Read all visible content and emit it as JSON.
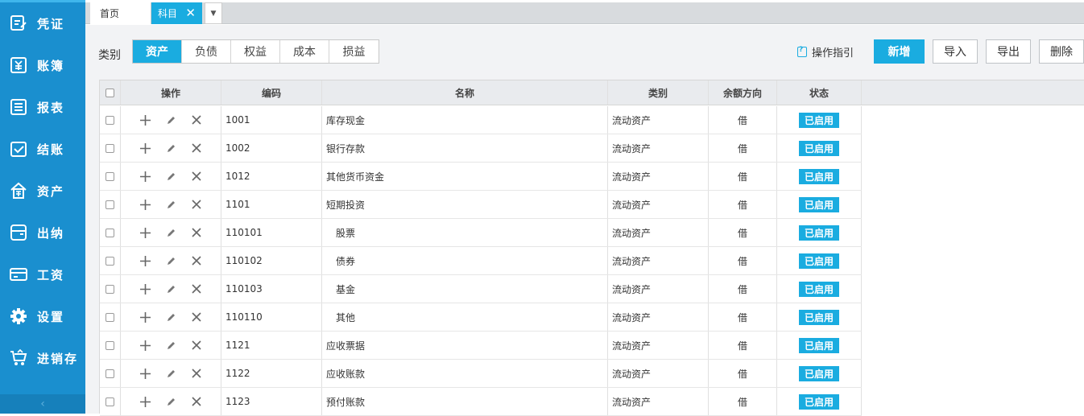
{
  "sidebar": {
    "items": [
      {
        "label": "凭证",
        "icon": "voucher-icon"
      },
      {
        "label": "账簿",
        "icon": "ledger-icon"
      },
      {
        "label": "报表",
        "icon": "report-icon"
      },
      {
        "label": "结账",
        "icon": "checkout-icon"
      },
      {
        "label": "资产",
        "icon": "asset-icon"
      },
      {
        "label": "出纳",
        "icon": "cashier-icon"
      },
      {
        "label": "工资",
        "icon": "salary-icon"
      },
      {
        "label": "设置",
        "icon": "gear-icon"
      },
      {
        "label": "进销存",
        "icon": "cart-icon"
      }
    ],
    "collapse_glyph": "‹"
  },
  "tabs": {
    "home": "首页",
    "active": "科目",
    "close_glyph": "✕",
    "more_glyph": "▼"
  },
  "toolbar": {
    "category_label": "类别",
    "segments": [
      "资产",
      "负债",
      "权益",
      "成本",
      "损益"
    ],
    "active_segment": "资产",
    "guide_label": "操作指引",
    "new_label": "新增",
    "import_label": "导入",
    "export_label": "导出",
    "delete_label": "删除"
  },
  "table": {
    "headers": {
      "ops": "操作",
      "code": "编码",
      "name": "名称",
      "category": "类别",
      "direction": "余额方向",
      "status": "状态"
    },
    "rows": [
      {
        "code": "1001",
        "name": "库存现金",
        "category": "流动资产",
        "direction": "借",
        "status": "已启用",
        "indent": false
      },
      {
        "code": "1002",
        "name": "银行存款",
        "category": "流动资产",
        "direction": "借",
        "status": "已启用",
        "indent": false
      },
      {
        "code": "1012",
        "name": "其他货币资金",
        "category": "流动资产",
        "direction": "借",
        "status": "已启用",
        "indent": false
      },
      {
        "code": "1101",
        "name": "短期投资",
        "category": "流动资产",
        "direction": "借",
        "status": "已启用",
        "indent": false
      },
      {
        "code": "110101",
        "name": "股票",
        "category": "流动资产",
        "direction": "借",
        "status": "已启用",
        "indent": true
      },
      {
        "code": "110102",
        "name": "债券",
        "category": "流动资产",
        "direction": "借",
        "status": "已启用",
        "indent": true
      },
      {
        "code": "110103",
        "name": "基金",
        "category": "流动资产",
        "direction": "借",
        "status": "已启用",
        "indent": true
      },
      {
        "code": "110110",
        "name": "其他",
        "category": "流动资产",
        "direction": "借",
        "status": "已启用",
        "indent": true
      },
      {
        "code": "1121",
        "name": "应收票据",
        "category": "流动资产",
        "direction": "借",
        "status": "已启用",
        "indent": false
      },
      {
        "code": "1122",
        "name": "应收账款",
        "category": "流动资产",
        "direction": "借",
        "status": "已启用",
        "indent": false
      },
      {
        "code": "1123",
        "name": "预付账款",
        "category": "流动资产",
        "direction": "借",
        "status": "已启用",
        "indent": false
      }
    ]
  },
  "colors": {
    "sidebar_bg": "#1a8fcf",
    "accent": "#1aace0",
    "header_bg": "#e9ebee",
    "content_bg": "#f2f3f5"
  }
}
